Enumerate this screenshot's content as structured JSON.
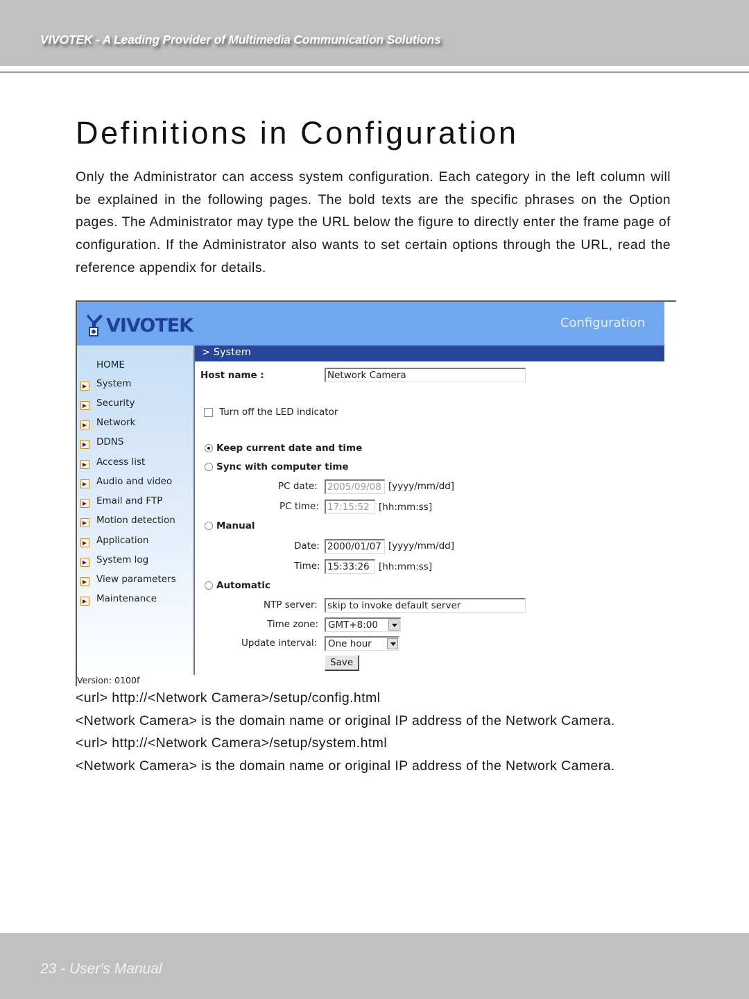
{
  "header": {
    "tagline": "VIVOTEK - A Leading Provider of Multimedia Communication Solutions"
  },
  "page_title": "Definitions in Configuration",
  "intro": "Only the Administrator can access system configuration. Each category in the left column will be explained in the following pages. The bold texts are the specific phrases on the Option pages. The Administrator may type the URL below the figure to directly enter the frame page of configuration. If the Administrator also wants to set certain options through the URL, read the reference appendix for details.",
  "screenshot": {
    "logo_text": "VIVOTEK",
    "banner_title": "Configuration",
    "colors": {
      "banner": "#70a7ee",
      "section_bar": "#27469a",
      "logo": "#1f3f9a"
    },
    "sidebar": {
      "home": "HOME",
      "items": [
        {
          "label": "System"
        },
        {
          "label": "Security"
        },
        {
          "label": "Network"
        },
        {
          "label": "DDNS"
        },
        {
          "label": "Access list"
        },
        {
          "label": "Audio and video"
        },
        {
          "label": "Email and FTP"
        },
        {
          "label": "Motion detection"
        },
        {
          "label": "Application"
        },
        {
          "label": "System log"
        },
        {
          "label": "View parameters"
        },
        {
          "label": "Maintenance"
        }
      ],
      "version": "Version: 0100f"
    },
    "section_title": "> System",
    "form": {
      "host_name_label": "Host name :",
      "host_name_value": "Network Camera",
      "led_label": "Turn off the LED indicator",
      "led_checked": false,
      "keep_label": "Keep current date and time",
      "keep_selected": true,
      "sync_label": "Sync with computer time",
      "pc_date_label": "PC date:",
      "pc_date_value": "2005/09/08",
      "date_format": "[yyyy/mm/dd]",
      "pc_time_label": "PC time:",
      "pc_time_value": "17:15:52",
      "time_format": "[hh:mm:ss]",
      "manual_label": "Manual",
      "date_label": "Date:",
      "date_value": "2000/01/07",
      "time_label": "Time:",
      "time_value": "15:33:26",
      "automatic_label": "Automatic",
      "ntp_label": "NTP server:",
      "ntp_value": "skip to invoke default server",
      "timezone_label": "Time zone:",
      "timezone_value": "GMT+8:00",
      "interval_label": "Update interval:",
      "interval_value": "One hour",
      "save_label": "Save"
    }
  },
  "urls": [
    "<url>  http://<Network Camera>/setup/config.html",
    "<Network Camera>  is the domain name or original IP address of the Network Camera.",
    "<url>  http://<Network Camera>/setup/system.html",
    "<Network Camera>  is the domain name or original IP address of the Network Camera."
  ],
  "footer": {
    "page_label": "23 - User's Manual"
  }
}
